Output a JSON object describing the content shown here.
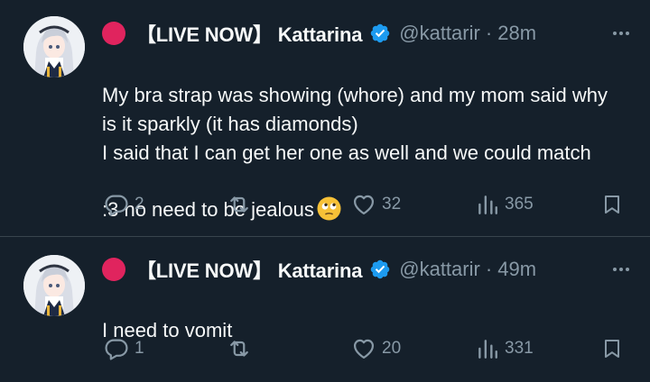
{
  "tweets": [
    {
      "display_name": "【LIVE NOW】 Kattarina",
      "handle": "@kattarir",
      "time": "· 28m",
      "text": "My bra strap was showing (whore) and my mom said why is it sparkly (it has diamonds)\nI said that I can get her one as well and we could match :3 no need to be jealous",
      "emoji": "face-with-rolling-eyes-emoji",
      "replies": "2",
      "reposts": "",
      "likes": "32",
      "views": "365"
    },
    {
      "display_name": "【LIVE NOW】 Kattarina",
      "handle": "@kattarir",
      "time": "· 49m",
      "text": "I need to vomit",
      "replies": "1",
      "reposts": "",
      "likes": "20",
      "views": "331"
    }
  ],
  "colors": {
    "background": "#15202b",
    "text": "#f7f9f9",
    "muted": "#8899a6",
    "verified": "#1d9bf0",
    "live_dot": "#e0245e",
    "divider": "#38444d"
  }
}
